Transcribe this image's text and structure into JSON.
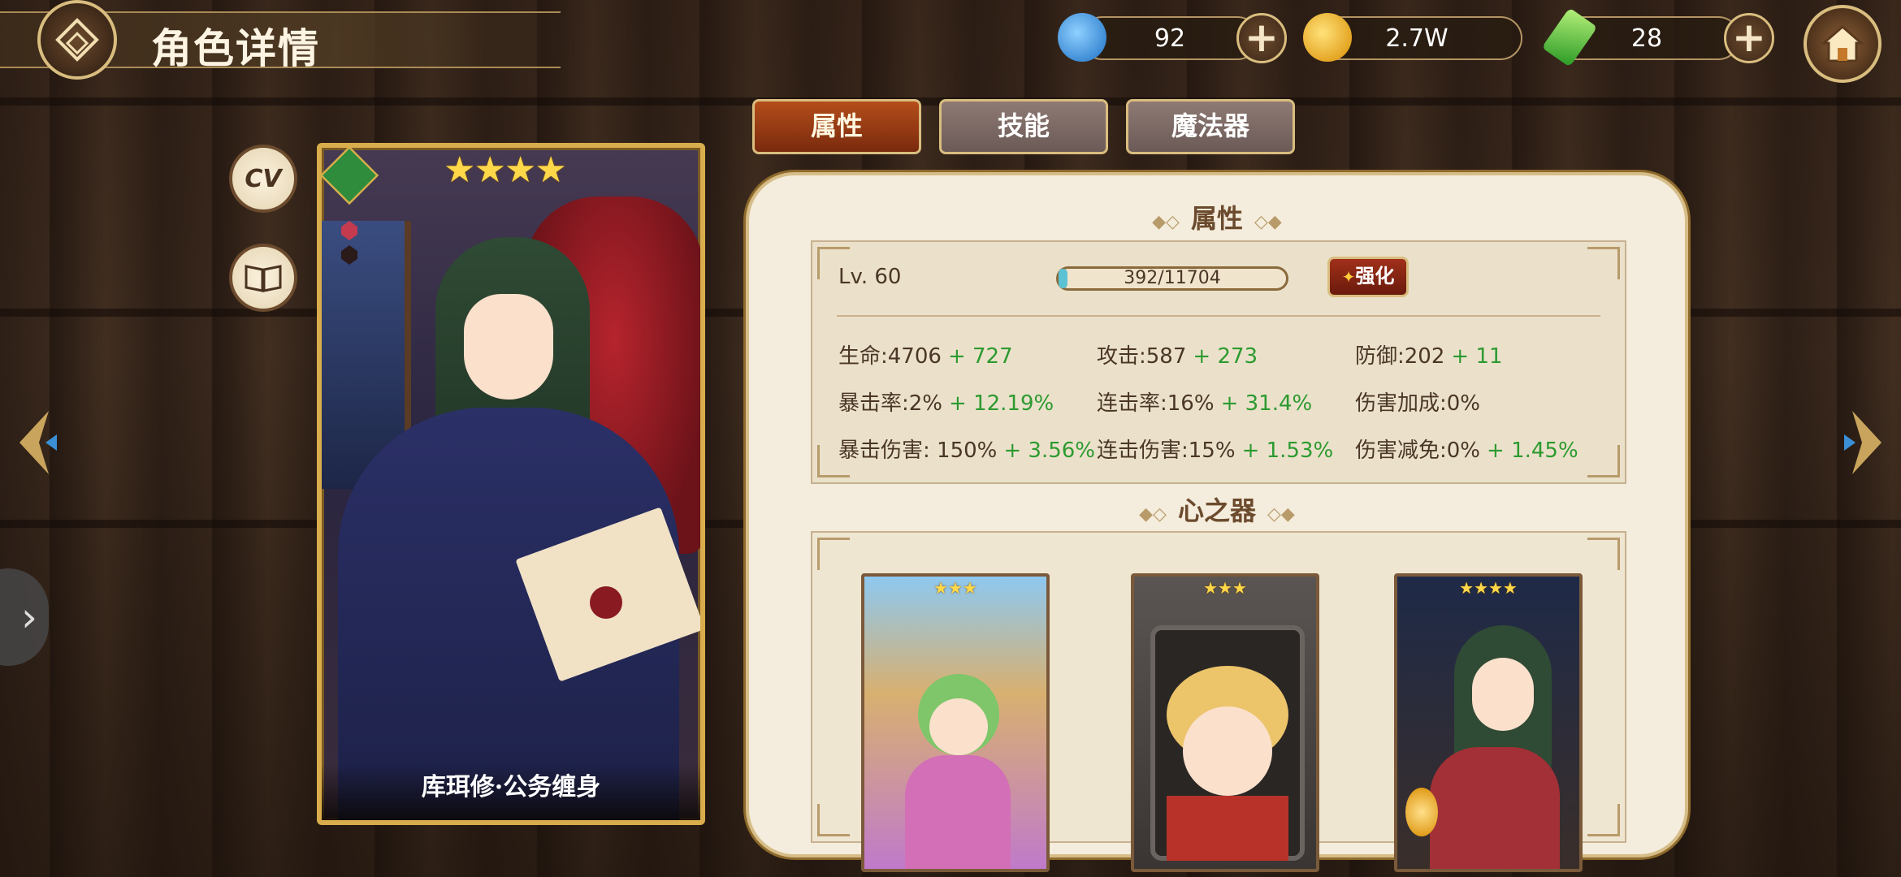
{
  "header": {
    "title": "角色详情"
  },
  "resources": [
    {
      "name": "crystal",
      "value": "92",
      "color": "#2e8fd6"
    },
    {
      "name": "gold",
      "value": "2.7W",
      "color": "#f2b21c"
    },
    {
      "name": "leaf-gem",
      "value": "28",
      "color": "#3fbf3a"
    }
  ],
  "side_buttons": {
    "cv_label": "CV"
  },
  "card": {
    "stars": "★★★★",
    "name": "库珥修·公务缠身"
  },
  "tabs": [
    {
      "label": "属性",
      "active": true
    },
    {
      "label": "技能",
      "active": false
    },
    {
      "label": "魔法器",
      "active": false
    }
  ],
  "attributes": {
    "section_title": "属性",
    "level": "Lv. 60",
    "xp_text": "392/11704",
    "xp_progress": 0.0335,
    "upgrade_label": "强化",
    "stats": [
      {
        "label": "生命:4706",
        "bonus": "+ 727"
      },
      {
        "label": "攻击:587",
        "bonus": "+ 273"
      },
      {
        "label": "防御:202",
        "bonus": "+ 11"
      },
      {
        "label": "暴击率:2%",
        "bonus": "+ 12.19%"
      },
      {
        "label": "连击率:16%",
        "bonus": "+ 31.4%"
      },
      {
        "label": "伤害加成:0%",
        "bonus": ""
      },
      {
        "label": "暴击伤害: 150%",
        "bonus": "+ 3.56%"
      },
      {
        "label": "连击伤害:15%",
        "bonus": "+ 1.53%"
      },
      {
        "label": "伤害减免:0%",
        "bonus": "+ 1.45%"
      }
    ]
  },
  "heart_vessels": {
    "section_title": "心之器",
    "items": [
      {
        "stars": "★★★",
        "accent": "#7fc66a"
      },
      {
        "stars": "★★★",
        "accent": "#e8c45a"
      },
      {
        "stars": "★★★★",
        "accent": "#2f4a35"
      }
    ]
  }
}
